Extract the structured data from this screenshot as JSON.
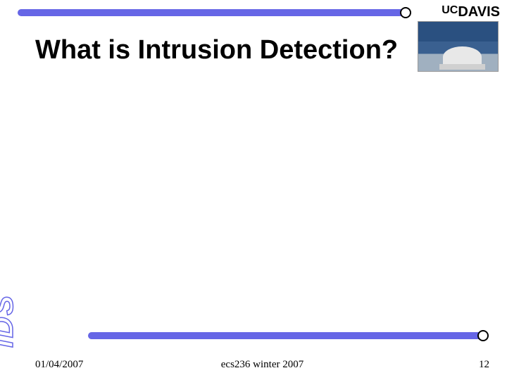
{
  "header": {
    "logo_uc": "UC",
    "logo_davis": "DAVIS"
  },
  "slide": {
    "title": "What is Intrusion Detection?"
  },
  "decoration": {
    "ids_label": "IDS"
  },
  "footer": {
    "date": "01/04/2007",
    "course": "ecs236 winter 2007",
    "page_number": "12"
  }
}
